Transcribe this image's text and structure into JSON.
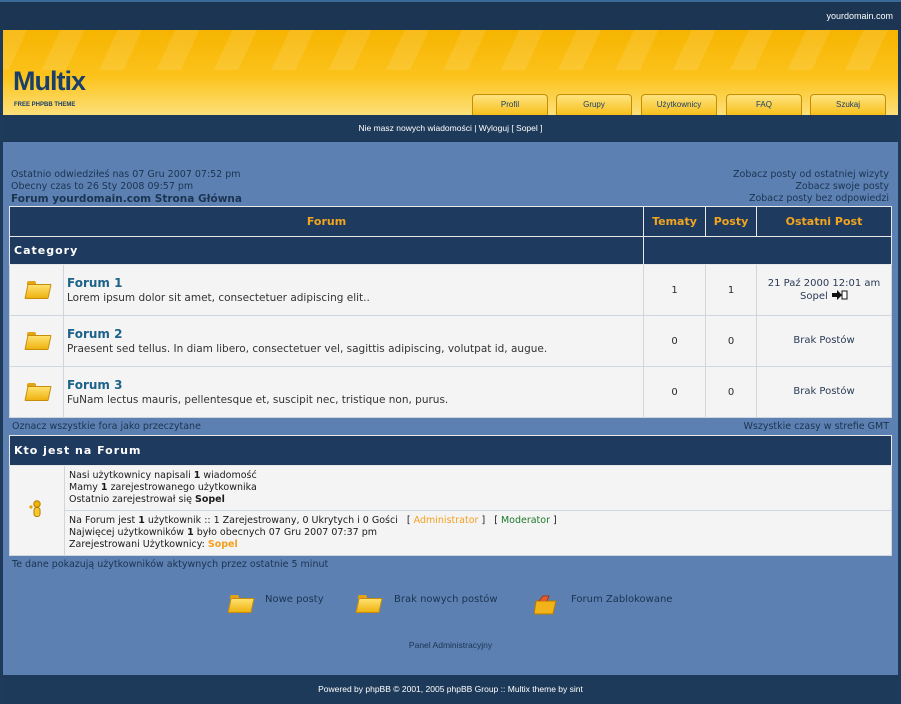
{
  "site": {
    "domain": "yourdomain.com"
  },
  "logo": {
    "title": "Multix",
    "subtitle": "FREE PHPBB THEME"
  },
  "nav": {
    "items": [
      "Profil",
      "Grupy",
      "Użytkownicy",
      "FAQ",
      "Szukaj"
    ]
  },
  "subbar": {
    "messages": "Nie masz nowych wiadomości",
    "sep": " | ",
    "logout": "Wyloguj [ Sopel ]"
  },
  "info": {
    "last_visit": "Ostatnio odwiedziłeś nas 07 Gru 2007 07:52 pm",
    "current_time": "Obecny czas to 26 Sty 2008 09:57 pm",
    "index_link": "Forum yourdomain.com Strona Główna",
    "links": [
      "Zobacz posty od ostatniej wizyty",
      "Zobacz swoje posty",
      "Zobacz posty bez odpowiedzi"
    ]
  },
  "forum_table": {
    "headers": [
      "Forum",
      "Tematy",
      "Posty",
      "Ostatni Post"
    ],
    "category": "Category",
    "rows": [
      {
        "name": "Forum 1",
        "desc": "Lorem ipsum dolor sit amet, consectetuer adipiscing elit..",
        "topics": "1",
        "posts": "1",
        "last_date": "21 Paź 2000 12:01 am",
        "last_user": "Sopel"
      },
      {
        "name": "Forum 2",
        "desc": "Praesent sed tellus. In diam libero, consectetuer vel, sagittis adipiscing, volutpat id, augue.",
        "topics": "0",
        "posts": "0",
        "last_text": "Brak Postów"
      },
      {
        "name": "Forum 3",
        "desc": "FuNam lectus mauris, pellentesque et, suscipit nec, tristique non, purus.",
        "topics": "0",
        "posts": "0",
        "last_text": "Brak Postów"
      }
    ]
  },
  "below": {
    "mark_read": "Oznacz wszystkie fora jako przeczytane",
    "timezone": "Wszystkie czasy w strefie GMT"
  },
  "who": {
    "title": "Kto jest na Forum",
    "l1a": "Nasi użytkownicy napisali ",
    "l1b": "1",
    "l1c": " wiadomość",
    "l2a": "Mamy ",
    "l2b": "1",
    "l2c": " zarejestrowanego użytkownika",
    "l3a": "Ostatnio zarejestrował się ",
    "l3b": "Sopel",
    "o1a": "Na Forum jest ",
    "o1b": "1",
    "o1c": " użytkownik :: 1 Zarejestrowany, 0 Ukrytych i 0 Gości",
    "admin": "Administrator",
    "moderator": "Moderator",
    "o2a": "Najwięcej użytkowników ",
    "o2b": "1",
    "o2c": " było obecnych 07 Gru 2007 07:37 pm",
    "o3a": "Zarejestrowani Użytkownicy: ",
    "o3b": "Sopel"
  },
  "active_note": "Te dane pokazują użytkowników aktywnych przez ostatnie 5 minut",
  "legend": {
    "new": "Nowe posty",
    "none": "Brak nowych postów",
    "locked": "Forum Zablokowane"
  },
  "admin_panel": "Panel Administracyjny",
  "footer": "Powered by phpBB © 2001, 2005 phpBB Group :: Multix theme by sint"
}
